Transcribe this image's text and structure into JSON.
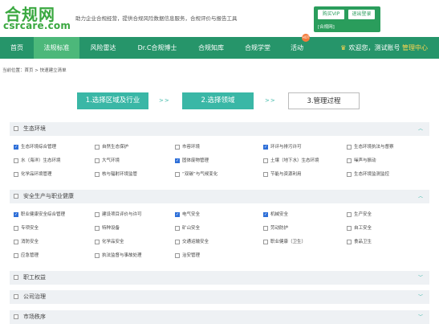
{
  "header": {
    "logo_cn": "合规网",
    "logo_en": "csrcare.com",
    "slogan": "助力企业合规经营，提供合规风险数据信息服务，合规评价与报告工具",
    "buy_vip": "购买VIP",
    "logout": "退出登录",
    "account_type": "[合规网]"
  },
  "nav": {
    "items": [
      "首页",
      "法规标准",
      "风险雷达",
      "Dr.C合规博士",
      "合规知库",
      "合规学堂",
      "活动"
    ],
    "hot_badge": "HOT",
    "welcome": "欢迎您，测试账号",
    "center": "管理中心"
  },
  "breadcrumb": "当前位置：首页 > 快速建立清单",
  "steps": {
    "step1": "1.选择区域及行业",
    "step2": "2.选择领域",
    "step3": "3.管理过程",
    "sep": ">>"
  },
  "sections": [
    {
      "title": "生态环境",
      "expanded": true,
      "rows": [
        [
          {
            "label": "生态环境综合管理",
            "checked": true
          },
          {
            "label": "自然生态保护",
            "checked": false
          },
          {
            "label": "市容环境",
            "checked": false
          },
          {
            "label": "环评与排污许可",
            "checked": true
          },
          {
            "label": "生态环境执法与督察",
            "checked": false
          }
        ],
        [
          {
            "label": "水（海洋）生态环境",
            "checked": false
          },
          {
            "label": "大气环境",
            "checked": false
          },
          {
            "label": "固体废物管理",
            "checked": true
          },
          {
            "label": "土壤（地下水）生态环境",
            "checked": false
          },
          {
            "label": "噪声与振动",
            "checked": false
          }
        ],
        [
          {
            "label": "化学品环境管理",
            "checked": false
          },
          {
            "label": "核与辐射环境监管",
            "checked": false
          },
          {
            "label": "“双碳”与气候变化",
            "checked": false
          },
          {
            "label": "节能与资源利用",
            "checked": false
          },
          {
            "label": "生态环境监测监控",
            "checked": false
          }
        ]
      ]
    },
    {
      "title": "安全生产与职业健康",
      "expanded": true,
      "rows": [
        [
          {
            "label": "职业健康安全综合管理",
            "checked": true
          },
          {
            "label": "建设项目评价与许可",
            "checked": false
          },
          {
            "label": "电气安全",
            "checked": true
          },
          {
            "label": "机械安全",
            "checked": true
          },
          {
            "label": "生产安全",
            "checked": false
          }
        ],
        [
          {
            "label": "专项安全",
            "checked": false
          },
          {
            "label": "特种设备",
            "checked": false
          },
          {
            "label": "矿山安全",
            "checked": false
          },
          {
            "label": "劳动防护",
            "checked": false
          },
          {
            "label": "自工安全",
            "checked": false
          }
        ],
        [
          {
            "label": "消防安全",
            "checked": false
          },
          {
            "label": "化学品安全",
            "checked": false
          },
          {
            "label": "交通运输安全",
            "checked": false
          },
          {
            "label": "职业健康（卫生）",
            "checked": false
          },
          {
            "label": "食品卫生",
            "checked": false
          }
        ],
        [
          {
            "label": "应急管理",
            "checked": false
          },
          {
            "label": "执法监督与事故处理",
            "checked": false
          },
          {
            "label": "治安管理",
            "checked": false
          }
        ]
      ]
    },
    {
      "title": "职工权益",
      "expanded": false,
      "rows": []
    },
    {
      "title": "公司治理",
      "expanded": false,
      "rows": []
    },
    {
      "title": "市场秩序",
      "expanded": false,
      "rows": []
    }
  ],
  "colors": {
    "brand_green": "#3aa840",
    "nav_bg": "#26956a",
    "nav_active": "#4cb87a",
    "step_done": "#3ab7a6",
    "checkbox_on": "#2e6fd8"
  },
  "icons": {
    "crown": "crown-icon",
    "chevron_up": "chevron-up-icon",
    "chevron_down": "chevron-down-icon"
  }
}
